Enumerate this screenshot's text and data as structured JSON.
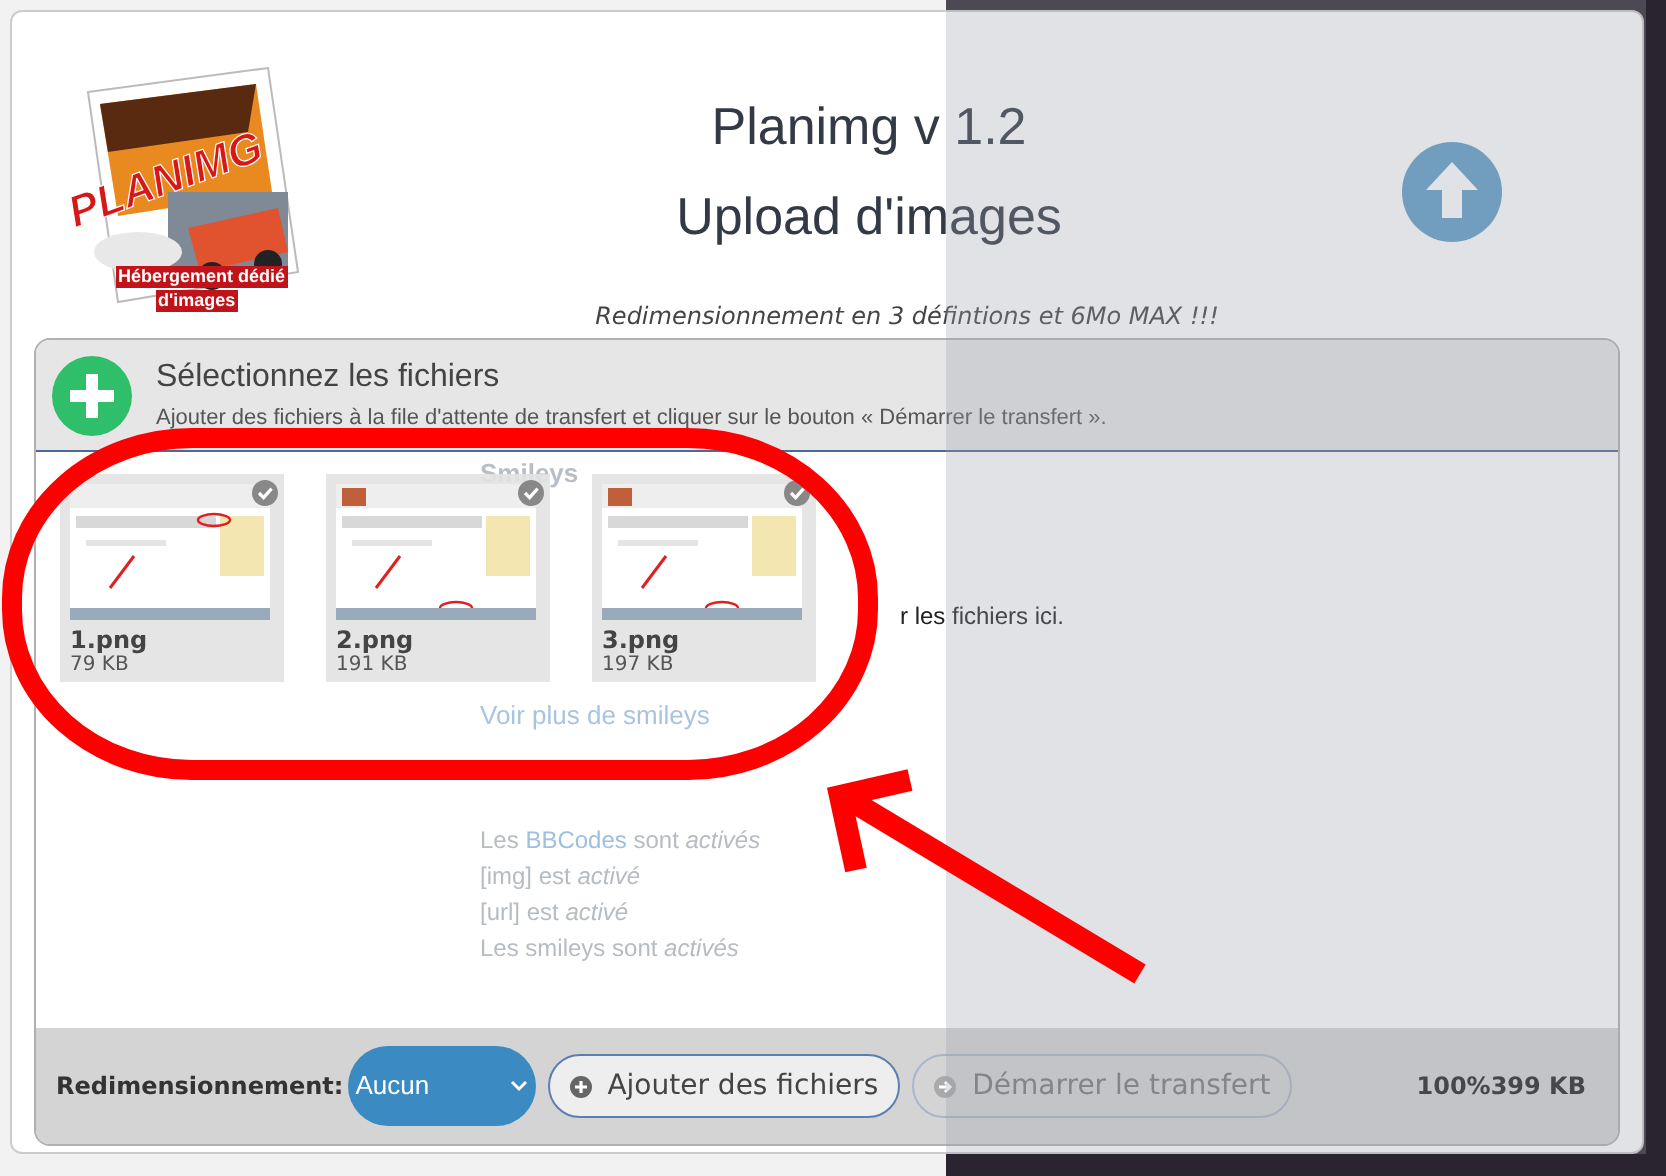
{
  "logo": {
    "wordmark": "PLANIMG",
    "tagline": [
      "Hébergement dédié",
      "d'images"
    ]
  },
  "header": {
    "title": "Planimg v 1.2",
    "subtitle": "Upload d'images",
    "note": "Redimensionnement en 3 défintions et 6Mo MAX !!!"
  },
  "background_page": {
    "heading": "Smileys",
    "link": "Voir plus de smileys",
    "rules": [
      [
        {
          "kind": "plain",
          "text": "Les "
        },
        {
          "kind": "link",
          "text": "BBCodes"
        },
        {
          "kind": "plain",
          "text": " sont "
        },
        {
          "kind": "em",
          "text": "activés"
        }
      ],
      [
        {
          "kind": "plain",
          "text": "[img] est "
        },
        {
          "kind": "em",
          "text": "activé"
        }
      ],
      [
        {
          "kind": "plain",
          "text": "[url] est "
        },
        {
          "kind": "em",
          "text": "activé"
        }
      ],
      [
        {
          "kind": "plain",
          "text": "Les smileys sont "
        },
        {
          "kind": "em",
          "text": "activés"
        }
      ]
    ]
  },
  "panel": {
    "title": "Sélectionnez les fichiers",
    "hint": "Ajouter des fichiers à la file d'attente de transfert et cliquer sur le bouton « Démarrer le transfert ».",
    "drop_text": "r les fichiers ici.",
    "files": [
      {
        "name": "1.png",
        "size": "79 KB"
      },
      {
        "name": "2.png",
        "size": "191 KB"
      },
      {
        "name": "3.png",
        "size": "197 KB"
      }
    ]
  },
  "footer": {
    "resize_label": "Redimensionnement:",
    "resize_value": "Aucun",
    "add_button": "Ajouter des fichiers",
    "start_button": {
      "label": "Démarrer le transfert",
      "disabled": true
    },
    "progress": "100%399 KB"
  }
}
